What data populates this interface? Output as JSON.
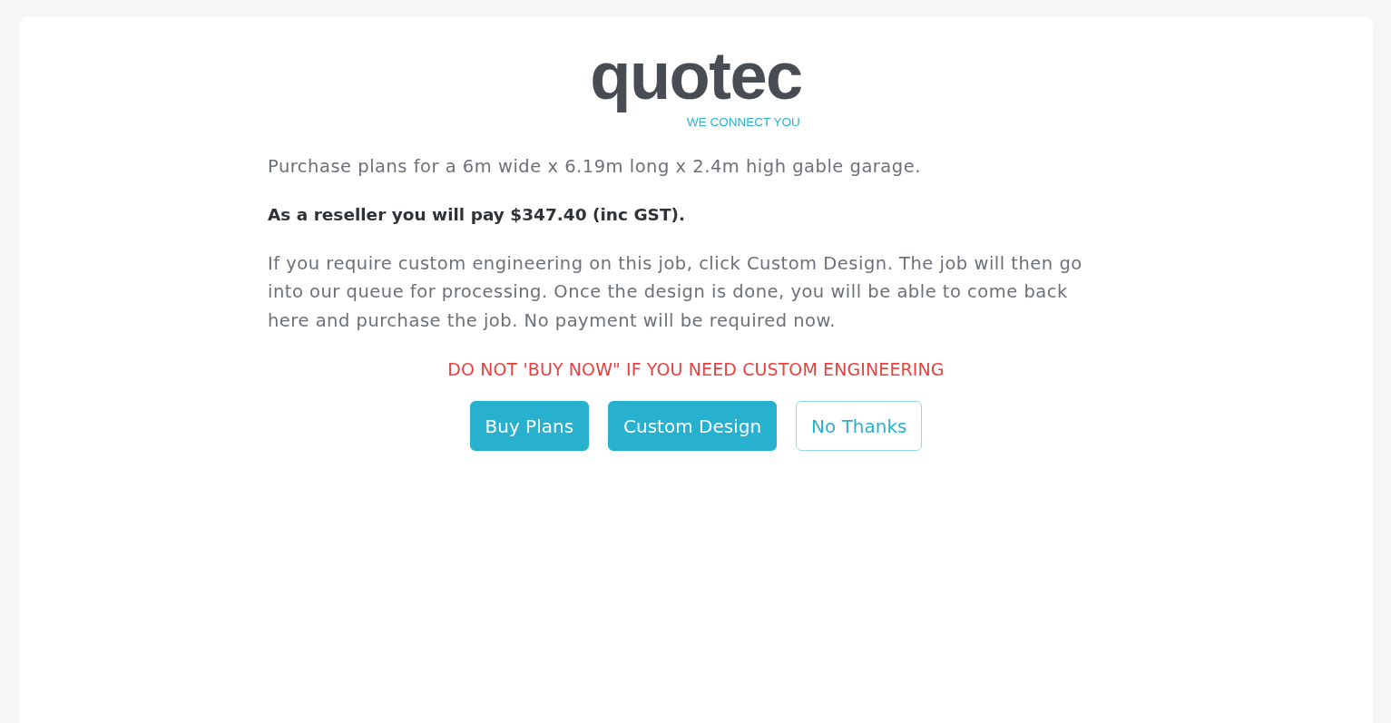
{
  "logo": {
    "wordmark": "quotec",
    "tagline": "WE CONNECT YOU"
  },
  "paragraphs": [
    {
      "kind": "plain",
      "text": "Purchase plans for a 6m wide x 6.19m long x 2.4m high gable garage."
    },
    {
      "kind": "emphasis",
      "text": "As a reseller you will pay $347.40 (inc GST)."
    },
    {
      "kind": "plain",
      "text": "If you require custom engineering on this job, click Custom Design. The job will then go into our queue for processing. Once the design is done, you will be able to come back here and purchase the job. No payment will be required now."
    }
  ],
  "warning": "DO NOT 'BUY NOW\" IF YOU NEED CUSTOM ENGINEERING",
  "buttons": [
    {
      "label": "Buy Plans",
      "kind": "primary"
    },
    {
      "label": "Custom Design",
      "kind": "primary"
    },
    {
      "label": "No Thanks",
      "kind": "outline"
    }
  ]
}
